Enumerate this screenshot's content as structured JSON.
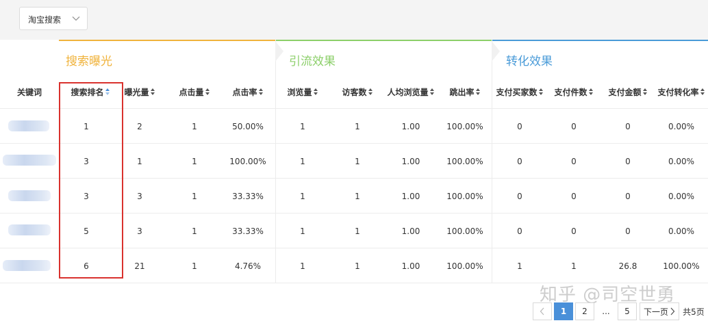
{
  "filter": {
    "value": "淘宝搜索",
    "chevron_icon": "chevron-down-icon"
  },
  "groups": [
    {
      "title": "搜索曝光",
      "color": "#f0b33c"
    },
    {
      "title": "引流效果",
      "color": "#8ccf6a"
    },
    {
      "title": "转化效果",
      "color": "#4a9bd8"
    }
  ],
  "columns": [
    "关键词",
    "搜索排名",
    "曝光量",
    "点击量",
    "点击率",
    "浏览量",
    "访客数",
    "人均浏览量",
    "跳出率",
    "支付买家数",
    "支付件数",
    "支付金额",
    "支付转化率"
  ],
  "rows": [
    [
      "",
      "1",
      "2",
      "1",
      "50.00%",
      "1",
      "1",
      "1.00",
      "100.00%",
      "0",
      "0",
      "0",
      "0.00%"
    ],
    [
      "",
      "3",
      "1",
      "1",
      "100.00%",
      "1",
      "1",
      "1.00",
      "100.00%",
      "0",
      "0",
      "0",
      "0.00%"
    ],
    [
      "",
      "3",
      "3",
      "1",
      "33.33%",
      "1",
      "1",
      "1.00",
      "100.00%",
      "0",
      "0",
      "0",
      "0.00%"
    ],
    [
      "",
      "5",
      "3",
      "1",
      "33.33%",
      "1",
      "1",
      "1.00",
      "100.00%",
      "0",
      "0",
      "0",
      "0.00%"
    ],
    [
      "",
      "6",
      "21",
      "1",
      "4.76%",
      "1",
      "1",
      "1.00",
      "100.00%",
      "1",
      "1",
      "26.8",
      "100.00%"
    ]
  ],
  "pagination": {
    "prev_icon": "chevron-left-icon",
    "pages": [
      "1",
      "2",
      "...",
      "5"
    ],
    "current": "1",
    "next": "下一页",
    "total": "共5页"
  },
  "watermark": "知乎 @司空世勇"
}
